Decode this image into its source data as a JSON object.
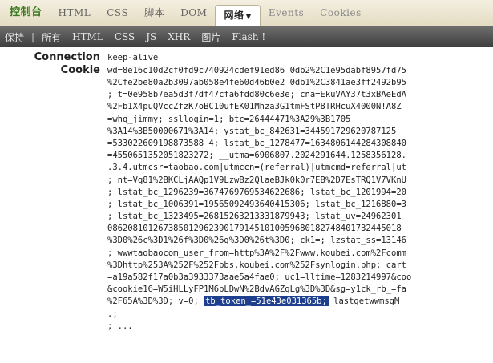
{
  "tabs": {
    "console": "控制台",
    "html": "HTML",
    "css": "CSS",
    "script": "脚本",
    "dom": "DOM",
    "net": "网络",
    "events": "Events",
    "cookies": "Cookies"
  },
  "subbar": {
    "save": "保持",
    "divider": "|",
    "all": "所有",
    "html": "HTML",
    "css": "CSS",
    "js": "JS",
    "xhr": "XHR",
    "images": "图片",
    "flash": "Flash !"
  },
  "headers": {
    "connection_label": "Connection",
    "connection_value": "keep-alive",
    "cookie_label": "Cookie",
    "cookie_first": "wd=8e16c10d2cf0fd9c740924cdef91ed86_0db2%2C1e95dabf8957fd75",
    "cookie_lines": [
      "%2Cfe2be80a2b3097ab058e4fe60d46b0e2_0db1%2C3841ae3ff2492b95",
      "; t=0e958b7ea5d3f7df47cfa6fdd80c6e3e; cna=EkuVAY37t3xBAeEdA",
      "%2Fb1X4puQVccZfzK7oBC10ufEK01Mhza3G1tmFStP8TRHcuX4000N!A8Z",
      "=whq_jimmy; ssllogin=1; btc=26444471%3A29%3B1705",
      "%3A14%3B50000671%3A14; ystat_bc_842631=344591729620787125",
      "=533022609198873588 4; lstat_bc_1278477=1634806144284308840",
      "=4550651352051823272; __utma=6906807.2024291644.1258356128.",
      ".3.4.utmcsr=taobao.com|utmccn=(referral)|utmcmd=referral|ut",
      "; nt=Vq81%2BKCLjAAQp1V9LzwBz2QlaeBJk0k0r7EB%2D7EsTRQ1V7VKnU",
      "; lstat_bc_1296239=3674769769534622686; lstat_bc_1201994=20",
      "; lstat_bc_1006391=19565092493640415306; lstat_bc_1216880=3",
      "; lstat_bc_1323495=26815263213331879943; lstat_uv=24962301",
      "0862081012673850129623901791451010059680182748401732445018",
      "%3D0%26c%3D1%26f%3D0%26g%3D0%26t%3D0; ck1=; lzstat_ss=13146",
      "; wwwtaobaocom_user_from=http%3A%2F%2Fwww.koubei.com%2Fcomm",
      "%3Dhttp%253A%252F%252Fbbs.koubei.com%252Fsynlogin.php; cart",
      "=a19a582f17a0b3a3933373aae5a4fae0; uc1=lltime=1283214997&coo",
      "&cookie16=W5iHLLyFP1M6bLDwN%2BdvAGZqLg%3D%3D&sg=y1ck_rb_=fa",
      "%2F65A%3D%3D; v=0; ",
      ".;",
      "; ..."
    ],
    "token_highlight": "tb_token_=51e43e031365b;",
    "after_token": " lastgetwwmsgM"
  }
}
